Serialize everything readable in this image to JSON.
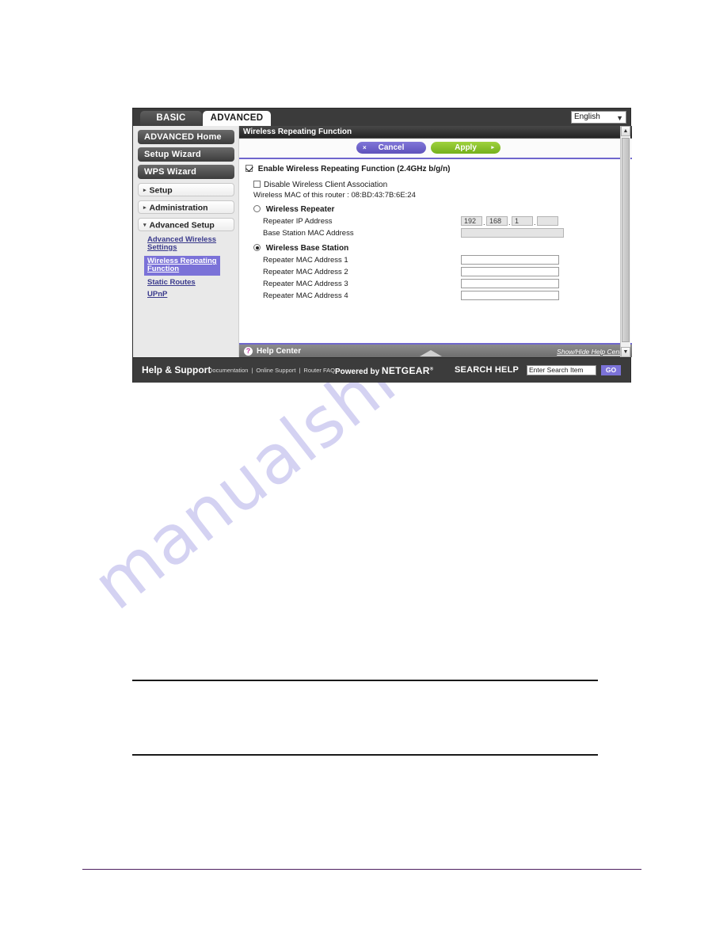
{
  "watermark": {
    "text": "manualshive.com"
  },
  "router_ui": {
    "tabs": [
      {
        "label": "BASIC",
        "active": false
      },
      {
        "label": "ADVANCED",
        "active": true
      }
    ],
    "language": {
      "selected": "English",
      "caret": "chevron-down-icon"
    },
    "sidebar": {
      "buttons": [
        {
          "label": "ADVANCED Home"
        },
        {
          "label": "Setup Wizard"
        },
        {
          "label": "WPS Wizard"
        }
      ],
      "groups": [
        {
          "label": "Setup",
          "expanded": false,
          "arrow": "▸"
        },
        {
          "label": "Administration",
          "expanded": false,
          "arrow": "▸"
        },
        {
          "label": "Advanced Setup",
          "expanded": true,
          "arrow": "▾"
        }
      ],
      "subitems": [
        {
          "label": "Advanced Wireless Settings",
          "active": false
        },
        {
          "label": "Wireless Repeating Function",
          "active": true
        },
        {
          "label": "Static Routes",
          "active": false
        },
        {
          "label": "UPnP",
          "active": false
        }
      ]
    },
    "panel": {
      "title": "Wireless Repeating Function",
      "buttons": {
        "cancel": {
          "label": "Cancel",
          "glyph": "×",
          "color": "#6e62c7"
        },
        "apply": {
          "label": "Apply",
          "glyph": "▸",
          "color": "#86c02c"
        }
      },
      "enable_checkbox": {
        "label": "Enable Wireless Repeating Function (2.4GHz b/g/n)",
        "checked": true
      },
      "disable_client_checkbox": {
        "label": "Disable Wireless Client Association",
        "checked": false
      },
      "router_mac_line": "Wireless MAC of this router : 08:BD:43:7B:6E:24",
      "repeater_mode": {
        "label": "Wireless Repeater",
        "selected": false,
        "ip_label": "Repeater IP Address",
        "ip_octets": [
          "192",
          "168",
          "1",
          ""
        ],
        "base_mac_label": "Base Station MAC Address",
        "base_mac_value": ""
      },
      "base_station_mode": {
        "label": "Wireless Base Station",
        "selected": true,
        "repeaters": [
          {
            "label": "Repeater MAC Address 1",
            "value": ""
          },
          {
            "label": "Repeater MAC Address 2",
            "value": ""
          },
          {
            "label": "Repeater MAC Address 3",
            "value": ""
          },
          {
            "label": "Repeater MAC Address 4",
            "value": ""
          }
        ]
      },
      "help_bar": {
        "icon": "question-mark-icon",
        "label": "Help Center",
        "toggle_label": "Show/Hide Help Center"
      },
      "scrollbar": {
        "up": "▲",
        "down": "▼"
      }
    },
    "footer": {
      "title": "Help & Support",
      "links": [
        "Documentation",
        "Online Support",
        "Router FAQ"
      ],
      "separator": "|",
      "powered_prefix": "Powered by ",
      "brand": "NETGEAR",
      "registered": "®",
      "search_label": "SEARCH HELP",
      "search_placeholder": "Enter Search Item",
      "go_label": "GO"
    }
  }
}
